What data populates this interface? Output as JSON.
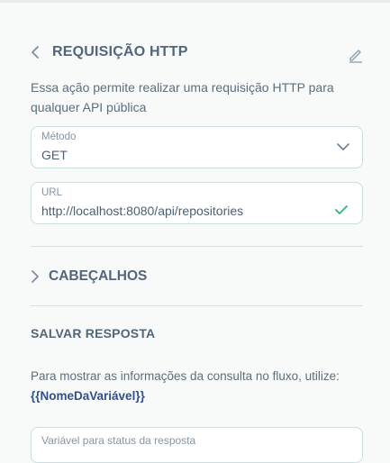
{
  "header": {
    "title": "REQUISIÇÃO HTTP",
    "description": "Essa ação permite realizar uma requisição HTTP para qualquer API pública"
  },
  "method_field": {
    "label": "Método",
    "value": "GET"
  },
  "url_field": {
    "label": "URL",
    "value": "http://localhost:8080/api/repositories"
  },
  "headers_section": {
    "label": "CABEÇALHOS"
  },
  "save_response": {
    "title": "SALVAR RESPOSTA",
    "description": "Para mostrar as informações da consulta no fluxo, utilize:",
    "variable_token": "{{NomeDaVariável}}",
    "status_placeholder": "Variável para status da resposta"
  },
  "colors": {
    "accent": "#2f4f8f",
    "success": "#2bb673",
    "border": "#c9dfdb"
  },
  "icons": {
    "back": "chevron-left-icon",
    "edit": "pencil-icon",
    "dropdown": "chevron-down-icon",
    "valid": "check-icon",
    "expand": "chevron-right-icon"
  }
}
